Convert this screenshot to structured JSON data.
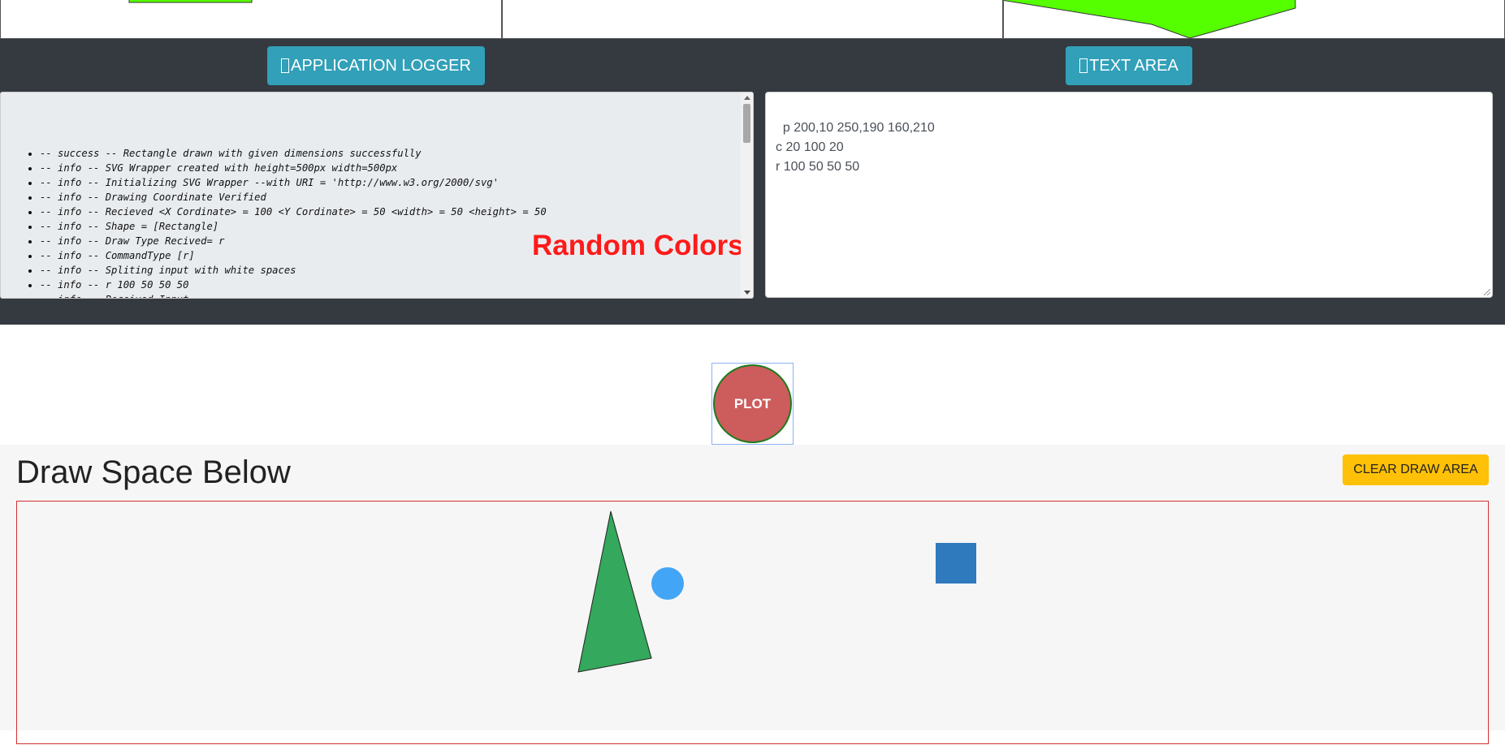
{
  "header": {
    "logger_button": "APPLICATION LOGGER",
    "textarea_button": "TEXT AREA"
  },
  "logger": {
    "watermark": "Random Colors",
    "entries": [
      "-- success -- Rectangle drawn with given dimensions successfully",
      "-- info -- SVG Wrapper created with height=500px width=500px",
      "-- info -- Initializing SVG Wrapper --with URI = 'http://www.w3.org/2000/svg'",
      "-- info -- Drawing Coordinate Verified",
      "-- info -- Recieved <X Cordinate> = 100 <Y Cordinate> = 50 <width> = 50 <height> = 50",
      "-- info -- Shape = [Rectangle]",
      "-- info -- Draw Type Recived= r",
      "-- info -- CommandType [r]",
      "-- info -- Spliting input with white spaces",
      "-- info -- r 100 50 50 50",
      "-- info -- Received Input"
    ]
  },
  "textarea": {
    "value": "p 200,10 250,190 160,210\nc 20 100 20\nr 100 50 50 50"
  },
  "plot": {
    "label": "PLOT"
  },
  "draw": {
    "title": "Draw Space Below",
    "clear_button": "CLEAR DRAW AREA"
  },
  "colors": {
    "dark_bg": "#343a40",
    "info_button": "#31a0b8",
    "warning_button": "#ffc107",
    "plot_button": "#cd5c5c",
    "draw_border": "#d32f2f",
    "triangle_fill": "#34a85c",
    "circle_fill": "#42a5f5",
    "square_fill": "#2f79bd",
    "preview_polygon": "#55ff00"
  }
}
